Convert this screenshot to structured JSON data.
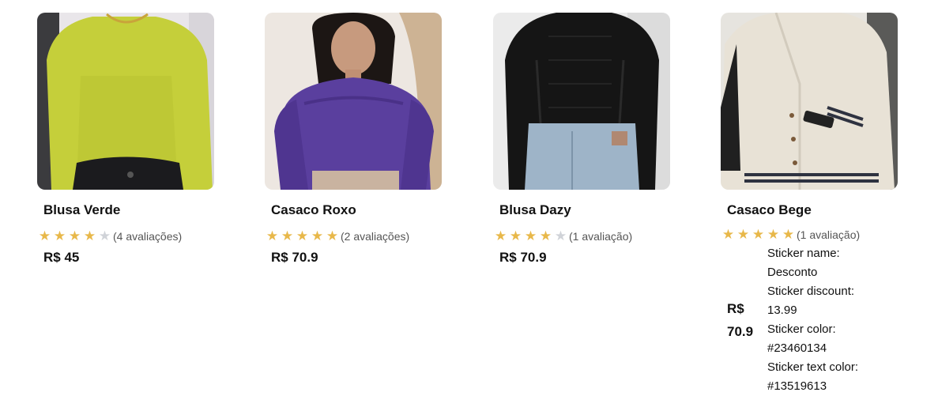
{
  "products": [
    {
      "name": "Blusa Verde",
      "image": "yellow-green long-sleeve blouse",
      "stars": 4,
      "rating_text": "(4 avaliações)",
      "price": "R$ 45"
    },
    {
      "name": "Casaco Roxo",
      "image": "purple knit sweater",
      "stars": 5,
      "rating_text": "(2 avaliações)",
      "price": "R$ 70.9"
    },
    {
      "name": "Blusa Dazy",
      "image": "black lace blouse with jeans",
      "stars": 4,
      "rating_text": "(1 avaliação)",
      "price": "R$ 70.9"
    },
    {
      "name": "Casaco Bege",
      "image": "beige knit cardigan",
      "stars": 5,
      "rating_text": "(1 avaliação)",
      "price_line1": "R$",
      "price_line2": "70.9",
      "sticker": {
        "name_label": "Sticker name:",
        "name_value": "Desconto",
        "discount_label": "Sticker discount:",
        "discount_value": "13.99",
        "color_label": "Sticker color:",
        "color_value": "#23460134",
        "text_color_label": "Sticker text color:",
        "text_color_value": "#13519613"
      }
    }
  ],
  "colors": {
    "star_filled": "#e8b84a",
    "star_empty": "#d0d3d8"
  }
}
